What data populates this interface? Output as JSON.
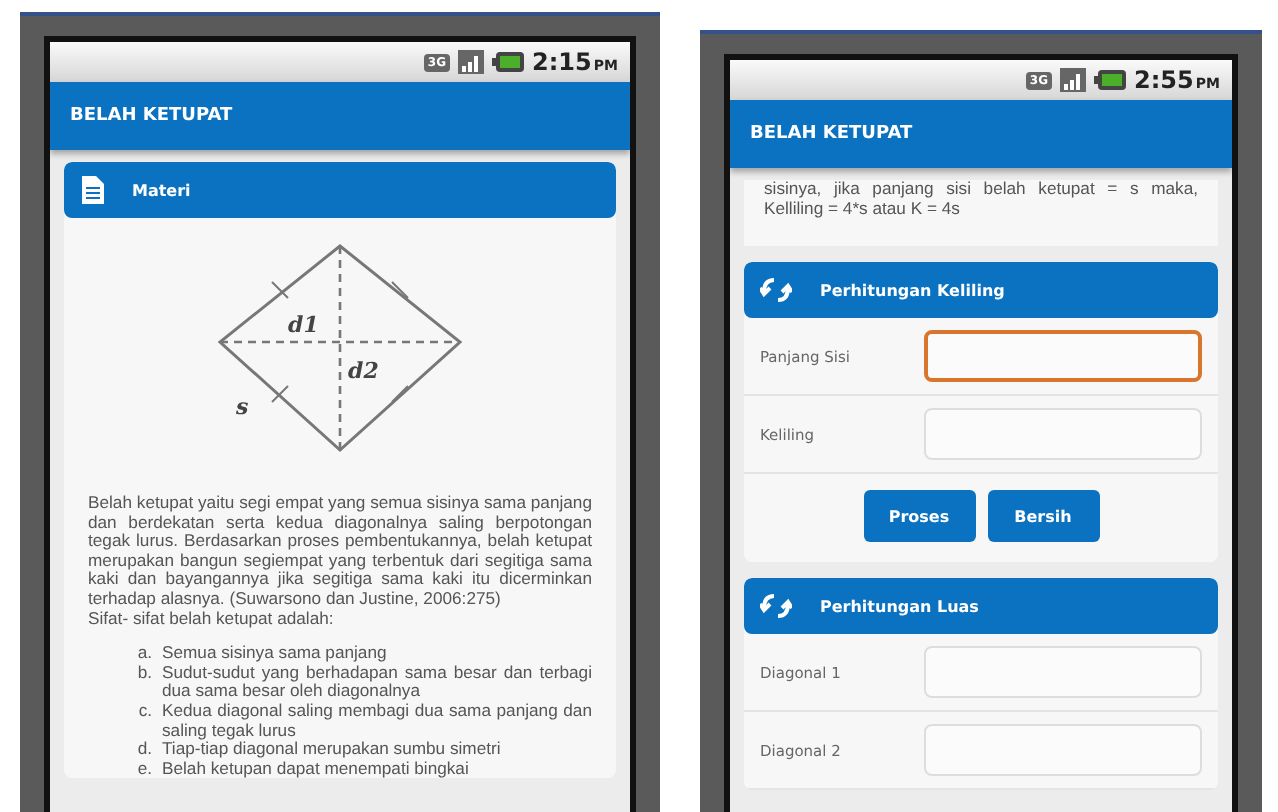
{
  "screens": [
    {
      "status": {
        "network": "3G",
        "time": "2:15",
        "meridiem": "PM"
      },
      "app_bar": {
        "title": "BELAH KETUPAT"
      },
      "sections": [
        {
          "kind": "material",
          "header": "Materi",
          "diagram_labels": [
            "d1",
            "d2",
            "s"
          ],
          "paragraph": "Belah ketupat yaitu segi empat yang semua sisinya sama panjang dan berdekatan serta kedua diagonalnya saling berpotongan tegak lurus. Berdasarkan proses pembentukannya, belah ketupat merupakan bangun segiempat yang terbentuk dari segitiga sama kaki dan bayangannya jika segitiga sama kaki itu dicerminkan terhadap alasnya. (Suwarsono dan Justine, 2006:275)",
          "list_title": "Sifat- sifat belah ketupat adalah:",
          "items": [
            {
              "marker": "a.",
              "text": "Semua sisinya sama panjang"
            },
            {
              "marker": "b.",
              "text": "Sudut-sudut yang berhadapan sama besar dan terbagi dua sama besar oleh diagonalnya"
            },
            {
              "marker": "c.",
              "text": "Kedua diagonal saling membagi dua sama panjang dan saling tegak lurus"
            },
            {
              "marker": "d.",
              "text": "Tiap-tiap diagonal merupakan sumbu simetri"
            },
            {
              "marker": "e.",
              "text": "Belah ketupan dapat menempati bingkai"
            }
          ]
        }
      ]
    },
    {
      "status": {
        "network": "3G",
        "time": "2:55",
        "meridiem": "PM"
      },
      "app_bar": {
        "title": "BELAH KETUPAT"
      },
      "sections": [
        {
          "kind": "text",
          "text": "sisinya, jika panjang sisi belah ketupat = s maka, Kelliling = 4*s atau K = 4s"
        },
        {
          "kind": "form",
          "header": "Perhitungan Keliling",
          "fields": [
            {
              "label": "Panjang Sisi",
              "focused": true
            },
            {
              "label": "Keliling",
              "focused": false
            }
          ],
          "buttons": [
            "Proses",
            "Bersih"
          ]
        },
        {
          "kind": "form",
          "header": "Perhitungan Luas",
          "fields": [
            {
              "label": "Diagonal 1",
              "focused": false
            },
            {
              "label": "Diagonal 2",
              "focused": false
            }
          ]
        }
      ]
    }
  ]
}
